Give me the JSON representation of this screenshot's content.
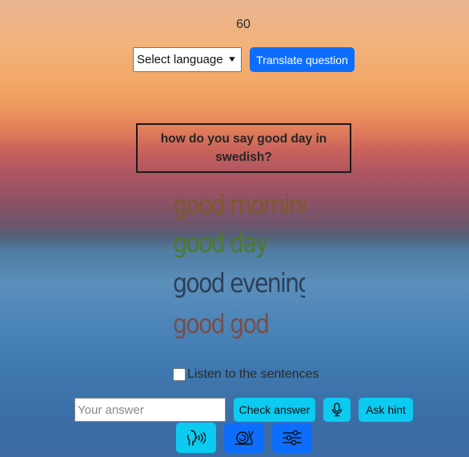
{
  "timer": "60",
  "language_select": {
    "selected": "Select language"
  },
  "translate_button": "Translate question",
  "question": "how do you say good day in swedish?",
  "options": [
    "good morning",
    "good day",
    "good evening",
    "good god"
  ],
  "listen_label": "Listen to the sentences",
  "answer_input": {
    "placeholder": "Your answer",
    "value": ""
  },
  "check_button": "Check answer",
  "hint_button": "Ask hint",
  "icons": {
    "microphone": "microphone-icon",
    "speak": "speaking-head-icon",
    "slow": "snail-icon",
    "settings": "sliders-icon"
  },
  "colors": {
    "primary": "#0d6efd",
    "info": "#0dcaf0",
    "option_1": "#7b5a2d",
    "option_2": "#4e7a2a",
    "option_3": "#2d3f57",
    "option_4": "#7a4e4a"
  }
}
